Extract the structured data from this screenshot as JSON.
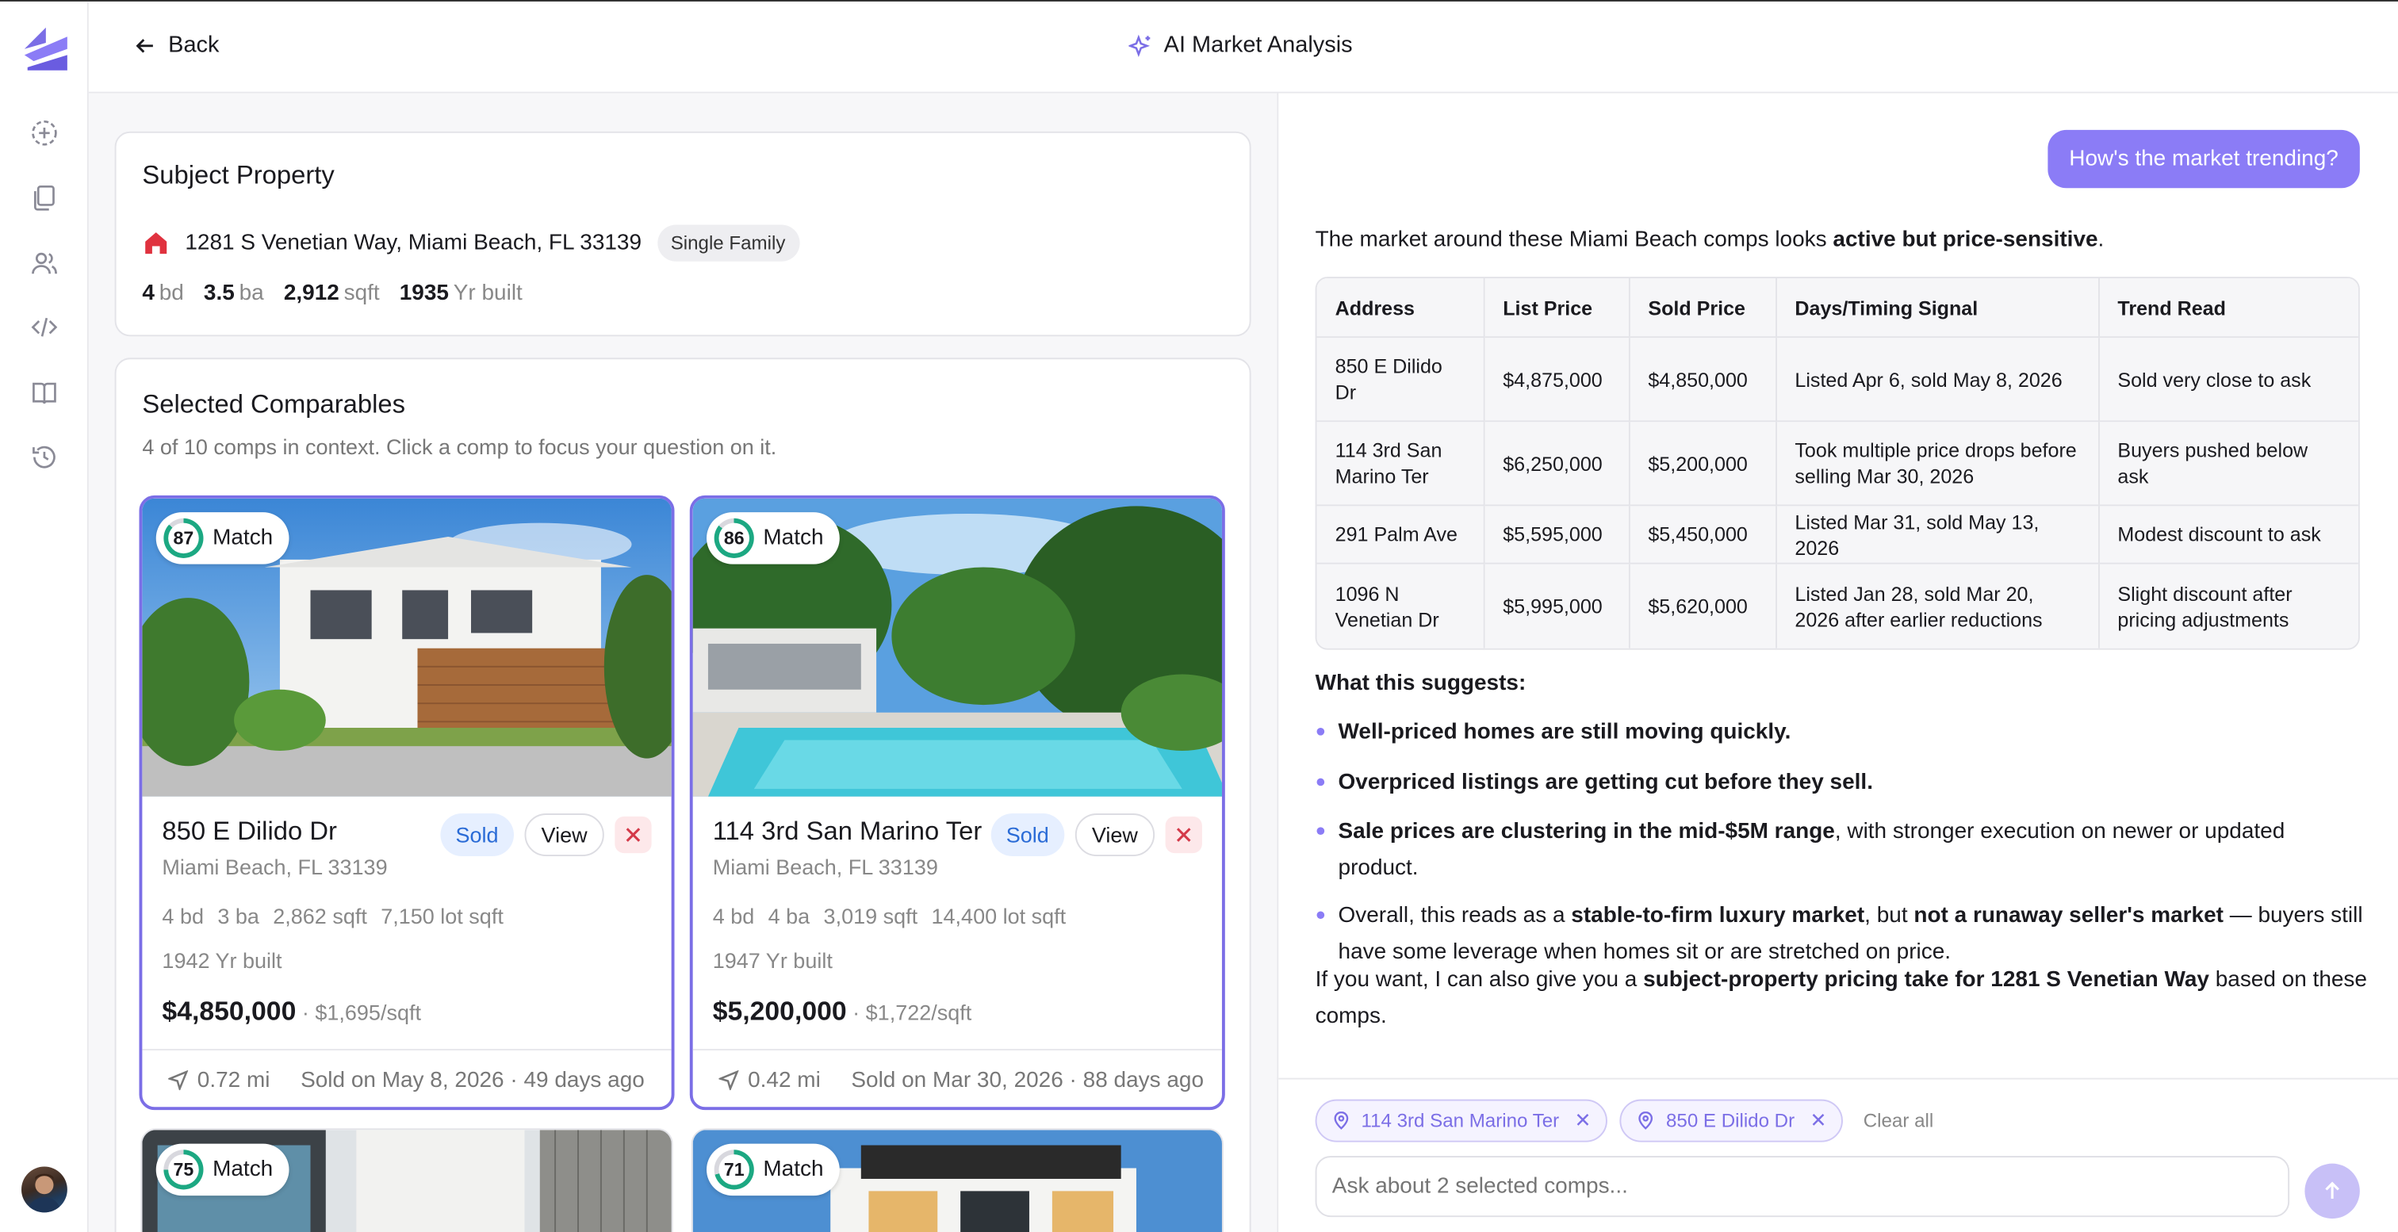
{
  "header": {
    "back_label": "Back",
    "title": "AI Market Analysis"
  },
  "sidebar": {
    "icons": [
      "new-icon",
      "documents-icon",
      "users-icon",
      "code-icon",
      "book-icon",
      "history-icon"
    ]
  },
  "subject": {
    "heading": "Subject Property",
    "address": "1281 S Venetian Way, Miami Beach, FL 33139",
    "type": "Single Family",
    "beds": "4",
    "beds_unit": "bd",
    "baths": "3.5",
    "baths_unit": "ba",
    "sqft": "2,912",
    "sqft_unit": "sqft",
    "year": "1935",
    "year_unit": "Yr built"
  },
  "comps": {
    "heading": "Selected Comparables",
    "subtitle": "4 of 10 comps in context. Click a comp to focus your question on it.",
    "match_label": "Match",
    "sold_label": "Sold",
    "view_label": "View",
    "items": [
      {
        "score": "87",
        "score_pct": 87,
        "title": "850 E Dilido Dr",
        "city": "Miami Beach, FL 33139",
        "beds": "4 bd",
        "baths": "3 ba",
        "sqft": "2,862 sqft",
        "lot": "7,150 lot sqft",
        "year": "1942 Yr built",
        "price": "$4,850,000",
        "ppsf": "· $1,695/sqft",
        "distance": "0.72 mi",
        "sold_on": "Sold on May 8, 2026 · 49 days ago"
      },
      {
        "score": "86",
        "score_pct": 86,
        "title": "114 3rd San Marino Ter",
        "city": "Miami Beach, FL 33139",
        "beds": "4 bd",
        "baths": "4 ba",
        "sqft": "3,019 sqft",
        "lot": "14,400 lot sqft",
        "year": "1947 Yr built",
        "price": "$5,200,000",
        "ppsf": "· $1,722/sqft",
        "distance": "0.42 mi",
        "sold_on": "Sold on Mar 30, 2026 · 88 days ago"
      },
      {
        "score": "75",
        "score_pct": 75
      },
      {
        "score": "71",
        "score_pct": 71
      }
    ]
  },
  "chat": {
    "user_message": "How's the market trending?",
    "intro_pre": "The market around these Miami Beach comps looks ",
    "intro_bold": "active but price-sensitive",
    "intro_post": ".",
    "table": {
      "headers": [
        "Address",
        "List Price",
        "Sold Price",
        "Days/Timing Signal",
        "Trend Read"
      ],
      "rows": [
        [
          "850 E Dilido Dr",
          "$4,875,000",
          "$4,850,000",
          "Listed Apr 6, sold May 8, 2026",
          "Sold very close to ask"
        ],
        [
          "114 3rd San Marino Ter",
          "$6,250,000",
          "$5,200,000",
          "Took multiple price drops before selling Mar 30, 2026",
          "Buyers pushed below ask"
        ],
        [
          "291 Palm Ave",
          "$5,595,000",
          "$5,450,000",
          "Listed Mar 31, sold May 13, 2026",
          "Modest discount to ask"
        ],
        [
          "1096 N Venetian Dr",
          "$5,995,000",
          "$5,620,000",
          "Listed Jan 28, sold Mar 20, 2026 after earlier reductions",
          "Slight discount after pricing adjustments"
        ]
      ]
    },
    "suggest_heading": "What this suggests:",
    "bullets": [
      {
        "bold": "Well-priced homes are still moving quickly.",
        "rest": ""
      },
      {
        "bold": "Overpriced listings are getting cut before they sell.",
        "rest": ""
      },
      {
        "bold": "Sale prices are clustering in the mid-$5M range",
        "rest": ", with stronger execution on newer or updated product."
      },
      {
        "pre": "Overall, this reads as a ",
        "bold": "stable-to-firm luxury market",
        "mid": ", but ",
        "bold2": "not a runaway seller's market",
        "rest": " — buyers still have some leverage when homes sit or are stretched on price."
      }
    ],
    "closing_pre": "If you want, I can also give you a ",
    "closing_bold": "subject-property pricing take for 1281 S Venetian Way",
    "closing_post": " based on these comps."
  },
  "composer": {
    "chips": [
      "114 3rd San Marino Ter",
      "850 E Dilido Dr"
    ],
    "clear_label": "Clear all",
    "placeholder": "Ask about 2 selected comps..."
  },
  "colors": {
    "accent": "#8b7cf6",
    "match_ring": "#1ca882",
    "sold_badge": "#2a6bd6",
    "remove": "#d43a4a"
  }
}
